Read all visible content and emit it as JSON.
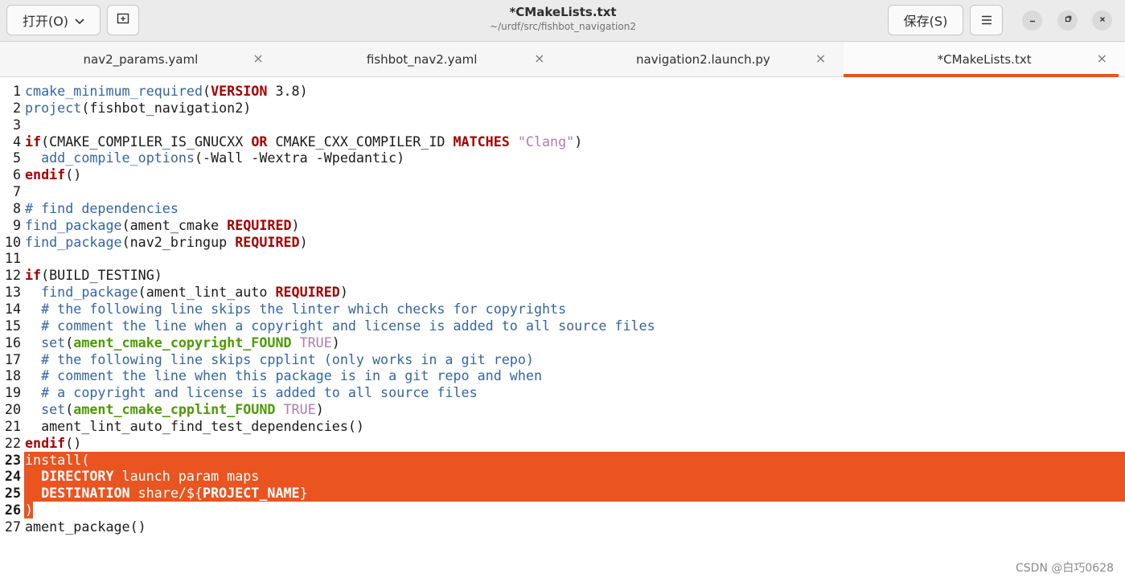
{
  "header": {
    "open_label": "打开(O)",
    "save_label": "保存(S)",
    "title": "*CMakeLists.txt",
    "subtitle": "~/urdf/src/fishbot_navigation2",
    "icons": {
      "chevron": "chevron-down-icon",
      "new_tab": "new-tab-icon",
      "menu": "hamburger-menu-icon",
      "minimize": "minimize-icon",
      "maximize": "maximize-icon",
      "close": "close-icon"
    }
  },
  "tabs": [
    {
      "label": "nav2_params.yaml",
      "active": false
    },
    {
      "label": "fishbot_nav2.yaml",
      "active": false
    },
    {
      "label": "navigation2.launch.py",
      "active": false
    },
    {
      "label": "*CMakeLists.txt",
      "active": true
    }
  ],
  "colors": {
    "accent": "#e95420",
    "function": "#3465a4",
    "keyword": "#a40000",
    "string": "#ad7fa8",
    "variable": "#4e9a06"
  },
  "editor": {
    "selected_lines": [
      23,
      24,
      25,
      26
    ],
    "lines": [
      {
        "n": "1",
        "tokens": [
          [
            "fn",
            "cmake_minimum_required"
          ],
          [
            "",
            "("
          ],
          [
            "kw",
            "VERSION"
          ],
          [
            "",
            " 3.8)"
          ]
        ]
      },
      {
        "n": "2",
        "tokens": [
          [
            "fn",
            "project"
          ],
          [
            "",
            "(fishbot_navigation2)"
          ]
        ]
      },
      {
        "n": "3",
        "tokens": []
      },
      {
        "n": "4",
        "tokens": [
          [
            "kw",
            "if"
          ],
          [
            "",
            "(CMAKE_COMPILER_IS_GNUCXX "
          ],
          [
            "kw",
            "OR"
          ],
          [
            "",
            " CMAKE_CXX_COMPILER_ID "
          ],
          [
            "kw",
            "MATCHES"
          ],
          [
            "",
            " "
          ],
          [
            "str",
            "\"Clang\""
          ],
          [
            "",
            ")"
          ]
        ]
      },
      {
        "n": "5",
        "tokens": [
          [
            "",
            "  "
          ],
          [
            "fn",
            "add_compile_options"
          ],
          [
            "",
            "(-Wall -Wextra -Wpedantic)"
          ]
        ]
      },
      {
        "n": "6",
        "tokens": [
          [
            "kw",
            "endif"
          ],
          [
            "",
            "()"
          ]
        ]
      },
      {
        "n": "7",
        "tokens": []
      },
      {
        "n": "8",
        "tokens": [
          [
            "cmt",
            "# find dependencies"
          ]
        ]
      },
      {
        "n": "9",
        "tokens": [
          [
            "fn",
            "find_package"
          ],
          [
            "",
            "(ament_cmake "
          ],
          [
            "kw",
            "REQUIRED"
          ],
          [
            "",
            ")"
          ]
        ]
      },
      {
        "n": "10",
        "tokens": [
          [
            "fn",
            "find_package"
          ],
          [
            "",
            "(nav2_bringup "
          ],
          [
            "kw",
            "REQUIRED"
          ],
          [
            "",
            ")"
          ]
        ]
      },
      {
        "n": "11",
        "tokens": []
      },
      {
        "n": "12",
        "tokens": [
          [
            "kw",
            "if"
          ],
          [
            "",
            "(BUILD_TESTING)"
          ]
        ]
      },
      {
        "n": "13",
        "tokens": [
          [
            "",
            "  "
          ],
          [
            "fn",
            "find_package"
          ],
          [
            "",
            "(ament_lint_auto "
          ],
          [
            "kw",
            "REQUIRED"
          ],
          [
            "",
            ")"
          ]
        ]
      },
      {
        "n": "14",
        "tokens": [
          [
            "",
            "  "
          ],
          [
            "cmt",
            "# the following line skips the linter which checks for copyrights"
          ]
        ]
      },
      {
        "n": "15",
        "tokens": [
          [
            "",
            "  "
          ],
          [
            "cmt",
            "# comment the line when a copyright and license is added to all source files"
          ]
        ]
      },
      {
        "n": "16",
        "tokens": [
          [
            "",
            "  "
          ],
          [
            "fn",
            "set"
          ],
          [
            "",
            "("
          ],
          [
            "var",
            "ament_cmake_copyright_FOUND"
          ],
          [
            "",
            " "
          ],
          [
            "str",
            "TRUE"
          ],
          [
            "",
            ")"
          ]
        ]
      },
      {
        "n": "17",
        "tokens": [
          [
            "",
            "  "
          ],
          [
            "cmt",
            "# the following line skips cpplint (only works in a git repo)"
          ]
        ]
      },
      {
        "n": "18",
        "tokens": [
          [
            "",
            "  "
          ],
          [
            "cmt",
            "# comment the line when this package is in a git repo and when"
          ]
        ]
      },
      {
        "n": "19",
        "tokens": [
          [
            "",
            "  "
          ],
          [
            "cmt",
            "# a copyright and license is added to all source files"
          ]
        ]
      },
      {
        "n": "20",
        "tokens": [
          [
            "",
            "  "
          ],
          [
            "fn",
            "set"
          ],
          [
            "",
            "("
          ],
          [
            "var",
            "ament_cmake_cpplint_FOUND"
          ],
          [
            "",
            " "
          ],
          [
            "str",
            "TRUE"
          ],
          [
            "",
            ")"
          ]
        ]
      },
      {
        "n": "21",
        "tokens": [
          [
            "",
            "  ament_lint_auto_find_test_dependencies()"
          ]
        ]
      },
      {
        "n": "22",
        "tokens": [
          [
            "kw",
            "endif"
          ],
          [
            "",
            "()"
          ]
        ]
      },
      {
        "n": "23",
        "tokens": [
          [
            "",
            "install("
          ]
        ]
      },
      {
        "n": "24",
        "tokens": [
          [
            "",
            "  "
          ],
          [
            "kw",
            "DIRECTORY"
          ],
          [
            "",
            " launch param maps"
          ]
        ]
      },
      {
        "n": "25",
        "tokens": [
          [
            "",
            "  "
          ],
          [
            "kw",
            "DESTINATION"
          ],
          [
            "",
            " share/${"
          ],
          [
            "kw",
            "PROJECT_NAME"
          ],
          [
            "",
            "}"
          ]
        ]
      },
      {
        "n": "26",
        "tokens": [
          [
            "",
            ")"
          ]
        ]
      },
      {
        "n": "27",
        "tokens": [
          [
            "",
            "ament_package()"
          ]
        ]
      }
    ]
  },
  "watermark": "CSDN @白巧0628"
}
